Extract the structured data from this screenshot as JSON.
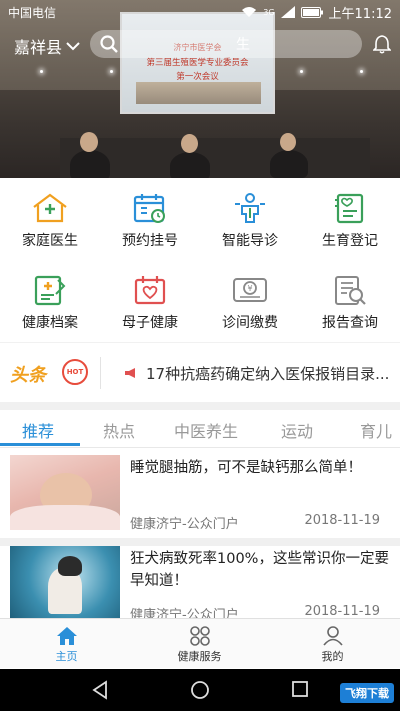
{
  "status": {
    "carrier": "中国电信",
    "network": "3G",
    "time": "上午11:12"
  },
  "header": {
    "city": "嘉祥县",
    "search_text": "生"
  },
  "banner": {
    "line1": "济宁市医学会",
    "line2": "第三届生殖医学专业委员会",
    "line3": "第一次会议"
  },
  "grid": [
    {
      "label": "家庭医生",
      "icon": "family-doctor-icon"
    },
    {
      "label": "预约挂号",
      "icon": "appointment-calendar-icon"
    },
    {
      "label": "智能导诊",
      "icon": "smart-guide-icon"
    },
    {
      "label": "生育登记",
      "icon": "birth-registration-icon"
    },
    {
      "label": "健康档案",
      "icon": "health-record-icon"
    },
    {
      "label": "母子健康",
      "icon": "mother-child-icon"
    },
    {
      "label": "诊间缴费",
      "icon": "payment-icon"
    },
    {
      "label": "报告查询",
      "icon": "report-query-icon"
    }
  ],
  "headline": {
    "badge": "头条",
    "hot": "HOT",
    "text": "17种抗癌药确定纳入医保报销目录..."
  },
  "tabs": [
    "推荐",
    "热点",
    "中医养生",
    "运动",
    "育儿"
  ],
  "articles": [
    {
      "title": "睡觉腿抽筋，可不是缺钙那么简单！",
      "source": "健康济宁-公众门户",
      "date": "2018-11-19"
    },
    {
      "title": "狂犬病致死率100%，这些常识你一定要早知道！",
      "source": "健康济宁-公众门户",
      "date": "2018-11-19"
    }
  ],
  "bottom_nav": [
    {
      "label": "主页",
      "icon": "home-icon"
    },
    {
      "label": "健康服务",
      "icon": "health-service-icon"
    },
    {
      "label": "我的",
      "icon": "profile-icon"
    }
  ],
  "watermark": "飞翔下载",
  "colors": {
    "accent": "#2a8fd8",
    "icon_green": "#3aa05a",
    "icon_blue": "#2a8fd8",
    "icon_yellow": "#f0a020",
    "icon_red": "#e05050"
  }
}
